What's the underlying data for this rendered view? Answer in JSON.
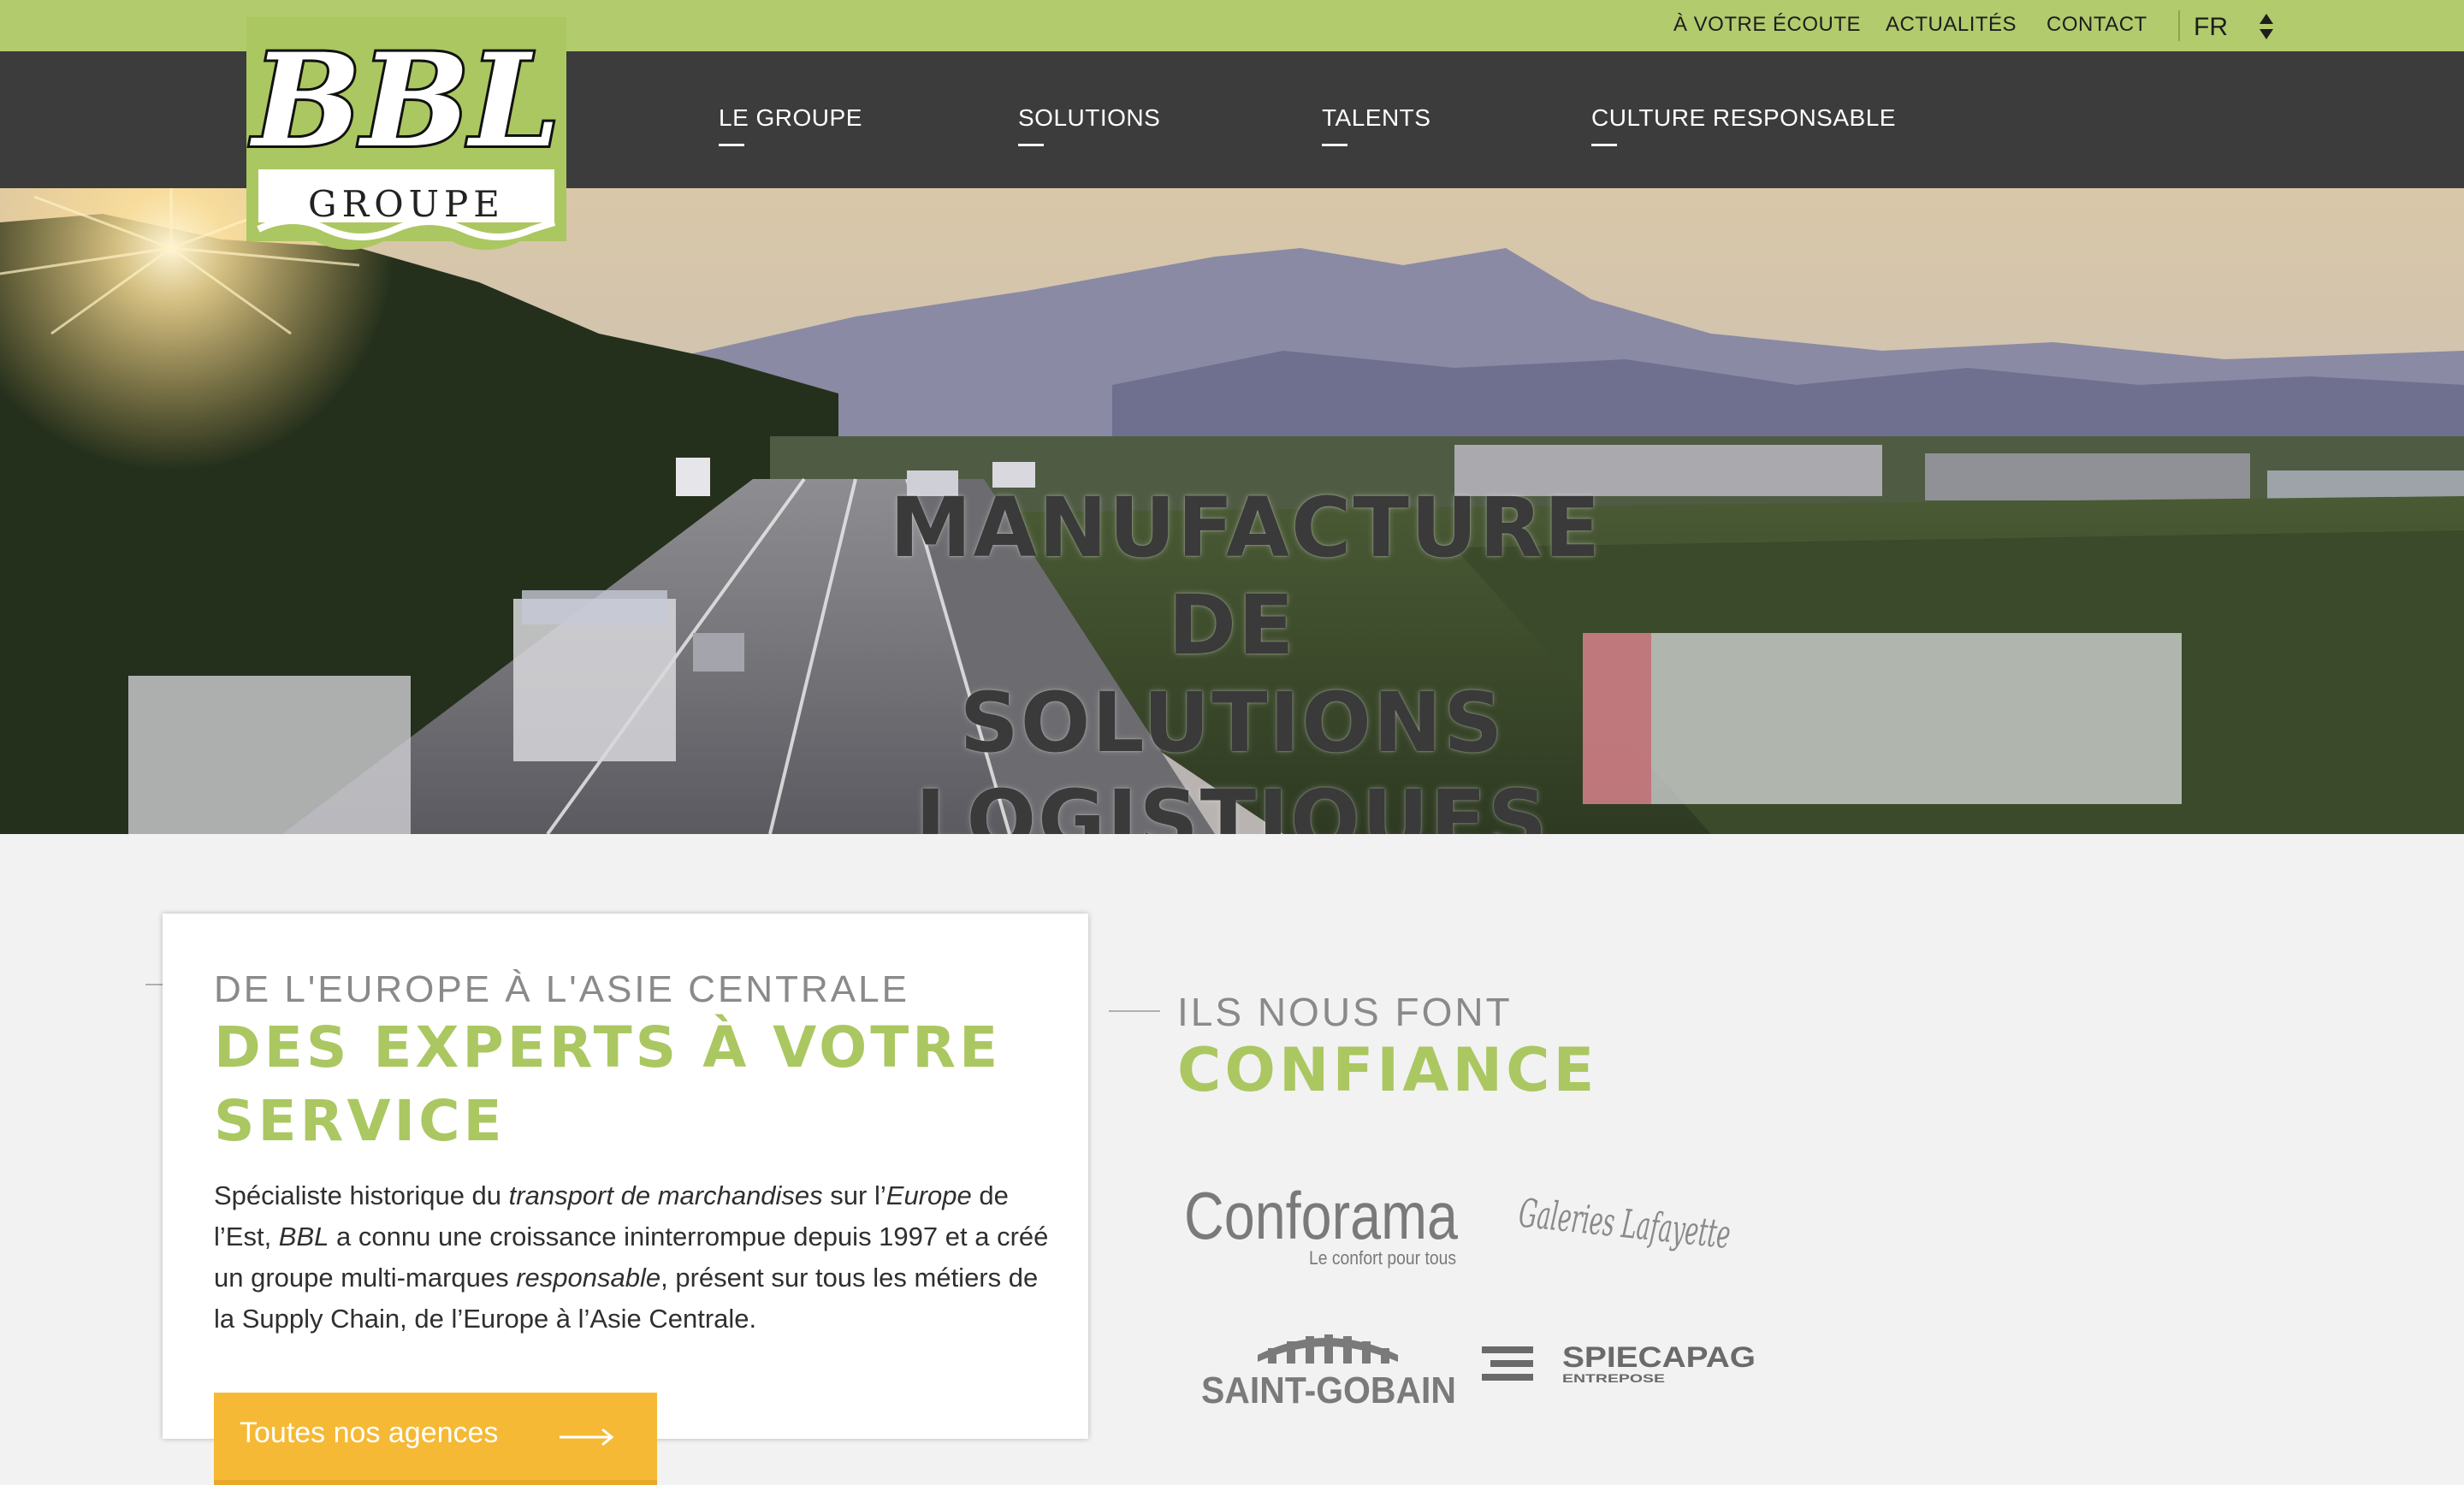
{
  "utility_nav": {
    "items": [
      "À VOTRE ÉCOUTE",
      "ACTUALITÉS",
      "CONTACT"
    ],
    "language": "FR"
  },
  "logo": {
    "mark": "BBL",
    "subtitle": "GROUPE"
  },
  "main_nav": {
    "items": [
      "LE GROUPE",
      "SOLUTIONS",
      "TALENTS",
      "CULTURE RESPONSABLE"
    ]
  },
  "hero": {
    "title_lines": [
      "MANUFACTURE",
      "DE SOLUTIONS",
      "LOGISTIQUES"
    ]
  },
  "intro": {
    "eyebrow": "DE L'EUROPE À L'ASIE CENTRALE",
    "heading": "DES EXPERTS À VOTRE SERVICE",
    "body": {
      "p1": "Spécialiste historique du ",
      "em1": "transport de marchandises",
      "p2": " sur l’",
      "em2": "Europe",
      "p3": " de l’Est, ",
      "em3": "BBL",
      "p4": " a connu une croissance ininterrompue depuis 1997 et a créé un groupe multi-marques ",
      "em4": "responsable",
      "p5": ", présent sur tous les métiers de la Supply Chain, de l’Europe à l’Asie Centrale."
    },
    "cta_label": "Toutes nos agences"
  },
  "trust": {
    "eyebrow": "ILS NOUS FONT",
    "heading": "CONFIANCE",
    "clients": [
      {
        "name": "Conforama",
        "tagline": "Le confort pour tous"
      },
      {
        "name": "Galeries Lafayette"
      },
      {
        "name": "SAINT-GOBAIN"
      },
      {
        "name": "SPIECAPAG",
        "tagline": "ENTREPOSE"
      }
    ]
  },
  "colors": {
    "brand_green": "#abc761",
    "topbar_green": "#b2cb6d",
    "nav_dark": "#3c3c3c",
    "cta_orange": "#f5b935",
    "page_bg": "#f2f2f2"
  }
}
